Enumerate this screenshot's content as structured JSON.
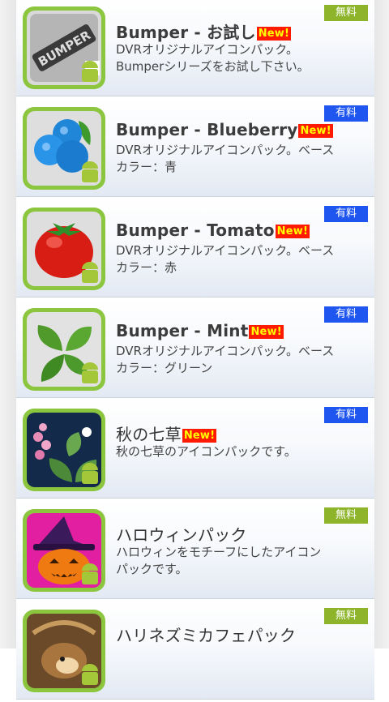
{
  "new_label": "New!",
  "items": [
    {
      "title": "Bumper - お試し",
      "new": true,
      "price": "無料",
      "price_type": "free",
      "description": "DVRオリジナルアイコンパック。\nBumperシリーズをお試し下さい。",
      "icon": "bumper-trial-icon"
    },
    {
      "title": "Bumper - Blueberry",
      "new": true,
      "price": "有料",
      "price_type": "paid",
      "description": "DVRオリジナルアイコンパック。ベース\nカラー：青",
      "icon": "blueberry-icon"
    },
    {
      "title": "Bumper - Tomato",
      "new": true,
      "price": "有料",
      "price_type": "paid",
      "description": "DVRオリジナルアイコンパック。ベース\nカラー：赤",
      "icon": "tomato-icon"
    },
    {
      "title": "Bumper - Mint",
      "new": true,
      "price": "有料",
      "price_type": "paid",
      "description": "DVRオリジナルアイコンパック。ベース\nカラー：グリーン",
      "icon": "mint-icon"
    },
    {
      "title": "秋の七草",
      "new": true,
      "price": "有料",
      "price_type": "paid",
      "description": "秋の七草のアイコンパックです。",
      "icon": "autumn-flowers-icon"
    },
    {
      "title": "ハロウィンパック",
      "new": false,
      "price": "無料",
      "price_type": "free",
      "description": "ハロウィンをモチーフにしたアイコン\nパックです。",
      "icon": "halloween-icon"
    },
    {
      "title": "ハリネズミカフェパック",
      "new": false,
      "price": "無料",
      "price_type": "free",
      "description": "",
      "icon": "hedgehog-cafe-icon"
    }
  ]
}
